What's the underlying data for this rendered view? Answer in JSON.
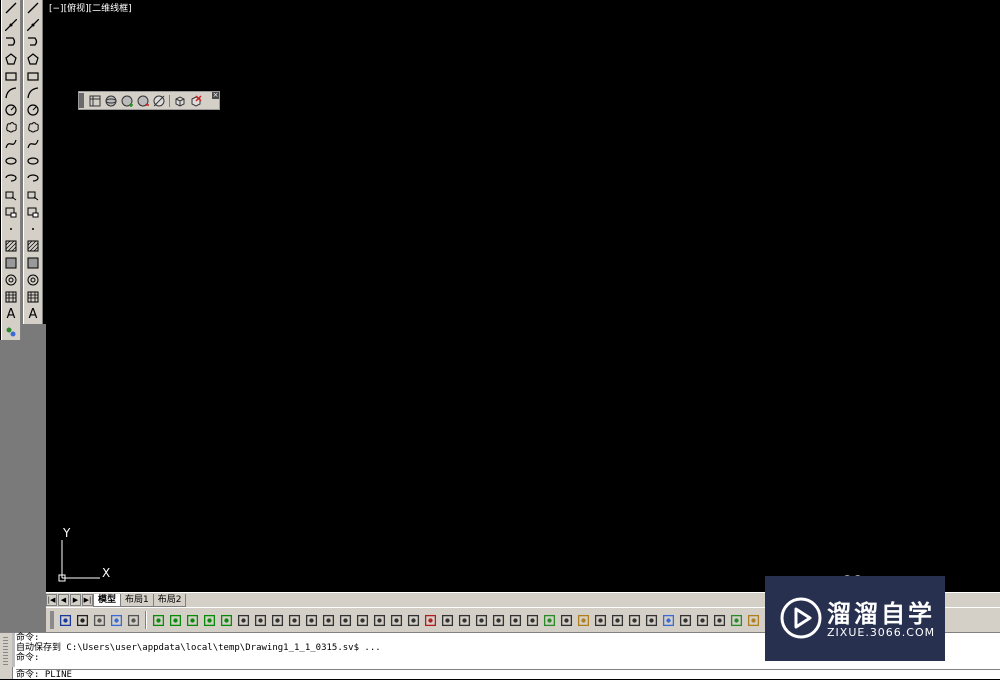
{
  "viewport": {
    "label": "[−][俯视][二维线框]"
  },
  "ucs": {
    "x_label": "X",
    "y_label": "Y"
  },
  "draw_toolbar": {
    "icons": [
      "line-icon",
      "construction-line-icon",
      "polyline-icon",
      "polygon-icon",
      "rectangle-icon",
      "arc-icon",
      "circle-icon",
      "revision-cloud-icon",
      "spline-icon",
      "ellipse-icon",
      "ellipse-arc-icon",
      "insert-block-icon",
      "make-block-icon",
      "point-icon",
      "hatch-icon",
      "gradient-icon",
      "region-icon",
      "table-icon",
      "multiline-text-icon",
      "add-selected-icon"
    ],
    "text_glyph": "A"
  },
  "modify_toolbar": {
    "icons": [
      "line-icon",
      "construction-line-icon",
      "polyline-icon",
      "polygon-icon",
      "rectangle-icon",
      "arc-icon",
      "circle-icon",
      "revision-cloud-icon",
      "spline-icon",
      "ellipse-icon",
      "ellipse-arc-icon",
      "insert-block-icon",
      "make-block-icon",
      "point-icon",
      "hatch-icon",
      "gradient-icon",
      "region-icon",
      "table-icon",
      "multiline-text-icon"
    ],
    "text_glyph": "A"
  },
  "floating_toolbar": {
    "icons": [
      "3d-grid-icon",
      "sphere-view-icon",
      "sphere-add-icon",
      "sphere-remove-icon",
      "sphere-slice-icon",
      "box-view-icon",
      "delete-view-icon"
    ],
    "close": "×"
  },
  "layout_tabs": {
    "nav": [
      "|◀",
      "◀",
      "▶",
      "▶|"
    ],
    "tabs": [
      {
        "label": "模型",
        "active": true
      },
      {
        "label": "布局1",
        "active": false
      },
      {
        "label": "布局2",
        "active": false
      }
    ]
  },
  "command": {
    "lines": [
      "命令:",
      "自动保存到 C:\\Users\\user\\appdata\\local\\temp\\Drawing1_1_1_0315.sv$ ...",
      "命令:"
    ],
    "current": "命令: PLINE"
  },
  "watermark": {
    "name": "溜溜自学",
    "url": "ZIXUE.3066.COM"
  },
  "colors": {
    "workspace": "#000000",
    "chrome": "#d4d0c8",
    "watermark_bg": "#28304f"
  }
}
